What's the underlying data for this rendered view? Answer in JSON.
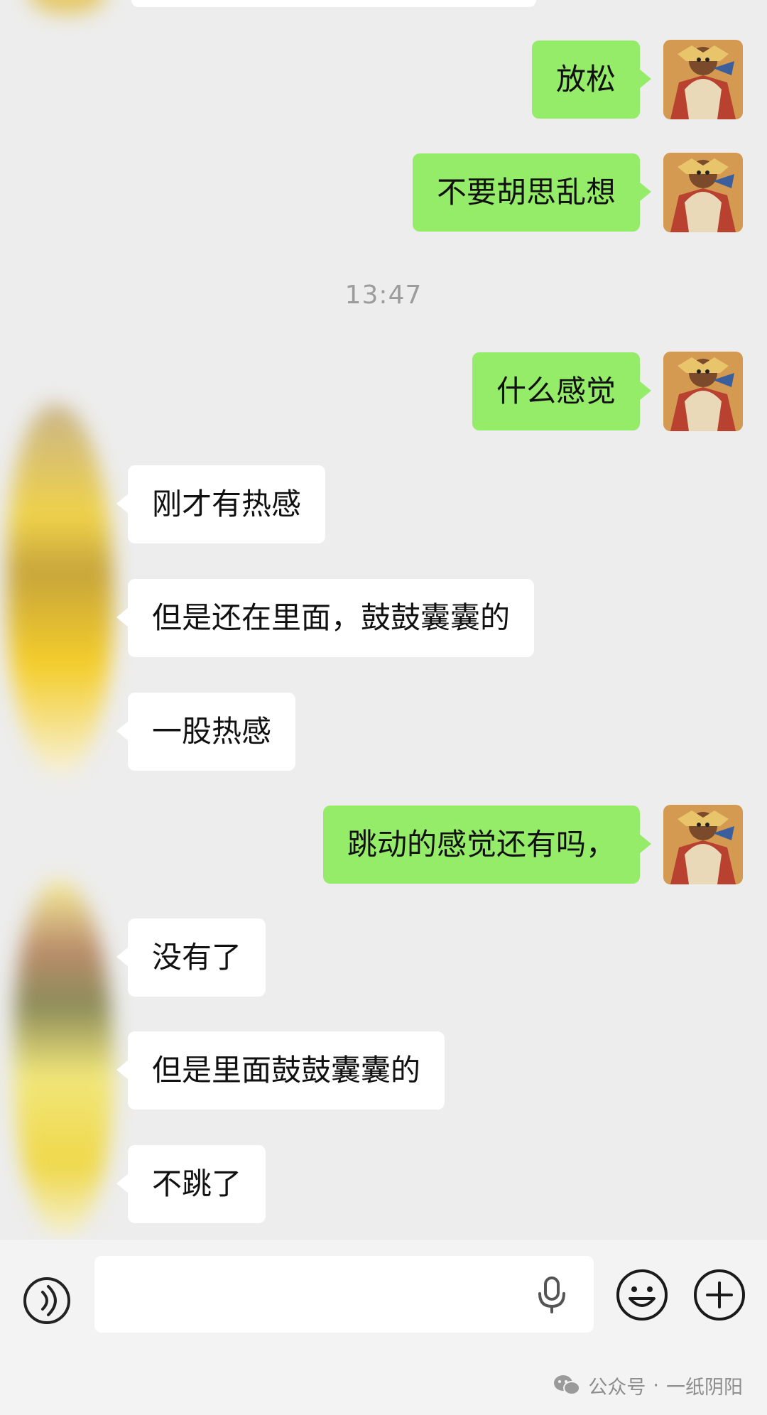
{
  "messages": [
    {
      "side": "me",
      "text": "放松"
    },
    {
      "side": "me",
      "text": "不要胡思乱想"
    },
    {
      "side": "me",
      "text": "什么感觉"
    },
    {
      "side": "them",
      "text": "刚才有热感"
    },
    {
      "side": "them",
      "text": "但是还在里面，鼓鼓囊囊的"
    },
    {
      "side": "them",
      "text": "一股热感"
    },
    {
      "side": "me",
      "text": "跳动的感觉还有吗，"
    },
    {
      "side": "them",
      "text": "没有了"
    },
    {
      "side": "them",
      "text": "但是里面鼓鼓囊囊的"
    },
    {
      "side": "them",
      "text": "不跳了"
    }
  ],
  "timestamp": "13:47",
  "watermark": {
    "source": "公众号",
    "separator": "·",
    "account": "一纸阴阳"
  },
  "colors": {
    "background": "#ededed",
    "my_bubble": "#95ec69",
    "their_bubble": "#ffffff"
  }
}
